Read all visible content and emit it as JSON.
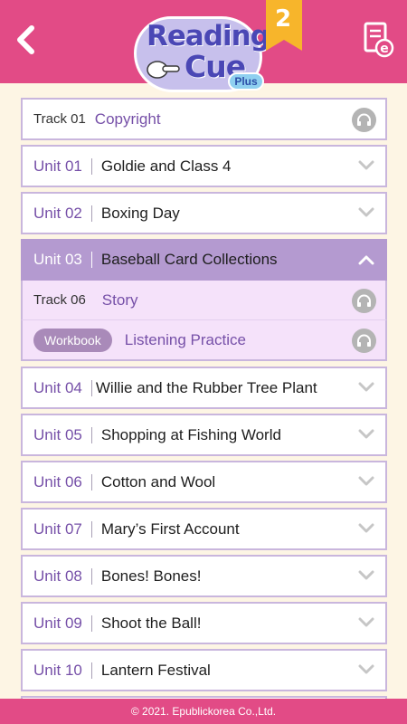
{
  "header": {
    "back_label": "back",
    "logo": {
      "line1": "Reading",
      "line2": "Cue",
      "plus": "Plus"
    },
    "level": "2",
    "ebook_label": "e"
  },
  "colors": {
    "header": "#e24b86",
    "accent_purple": "#7650a8",
    "active_row": "#b49ad0",
    "expanded_bg": "#f5e2fa",
    "audio_button": "#b4b4b4"
  },
  "tracks": {
    "copyright": {
      "track": "Track 01",
      "title": "Copyright",
      "icon": "headphones-icon"
    }
  },
  "units": [
    {
      "unit": "Unit 01",
      "title": "Goldie and Class 4",
      "expanded": false
    },
    {
      "unit": "Unit 02",
      "title": "Boxing Day",
      "expanded": false
    },
    {
      "unit": "Unit 03",
      "title": "Baseball Card Collections",
      "expanded": true,
      "items": [
        {
          "type": "track",
          "track": "Track 06",
          "title": "Story",
          "icon": "headphones-icon"
        },
        {
          "type": "workbook",
          "tag": "Workbook",
          "title": "Listening Practice",
          "icon": "headphones-icon"
        }
      ]
    },
    {
      "unit": "Unit 04",
      "title": "Willie and the Rubber Tree Plant",
      "expanded": false
    },
    {
      "unit": "Unit 05",
      "title": "Shopping at Fishing World",
      "expanded": false
    },
    {
      "unit": "Unit 06",
      "title": "Cotton and Wool",
      "expanded": false
    },
    {
      "unit": "Unit 07",
      "title": "Mary’s First Account",
      "expanded": false
    },
    {
      "unit": "Unit 08",
      "title": "Bones! Bones!",
      "expanded": false
    },
    {
      "unit": "Unit 09",
      "title": "Shoot the Ball!",
      "expanded": false
    },
    {
      "unit": "Unit 10",
      "title": "Lantern Festival",
      "expanded": false
    }
  ],
  "footer": {
    "copyright": "© 2021. Epublickorea Co.,Ltd."
  }
}
